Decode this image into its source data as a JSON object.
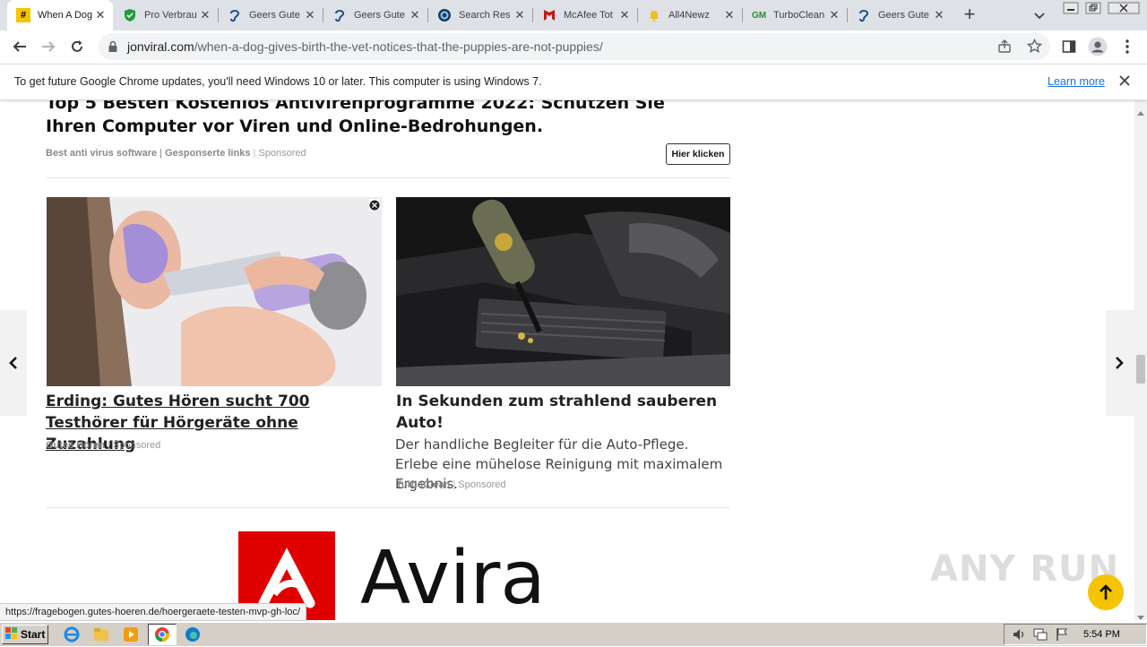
{
  "tabs": [
    {
      "title": "When A Dog",
      "icon": "hash-icon",
      "active": true
    },
    {
      "title": "Pro Verbrau",
      "icon": "shield-check-icon"
    },
    {
      "title": "Geers Gute",
      "icon": "ear-icon"
    },
    {
      "title": "Geers Gute",
      "icon": "ear-icon"
    },
    {
      "title": "Search Res",
      "icon": "search-engine-icon"
    },
    {
      "title": "McAfee Tot",
      "icon": "mcafee-icon"
    },
    {
      "title": "All4Newz",
      "icon": "bell-icon"
    },
    {
      "title": "TurboClean",
      "icon": "gm-icon"
    },
    {
      "title": "Geers Gute",
      "icon": "ear-icon"
    }
  ],
  "new_tab_label": "+",
  "address": {
    "domain": "jonviral.com",
    "path": "/when-a-dog-gives-birth-the-vet-notices-that-the-puppies-are-not-puppies/"
  },
  "infobar": {
    "message": "To get future Google Chrome updates, you'll need Windows 10 or later. This computer is using Windows 7.",
    "link": "Learn more"
  },
  "ad_top": {
    "title": "Top 5 Besten Kostenlos Antivirenprogramme 2022: Schützen Sie Ihren Computer vor Viren und Online-Bedrohungen.",
    "source1": "Best anti virus software",
    "source2": "Gesponserte links",
    "sponsored": "Sponsored",
    "cta": "Hier klicken"
  },
  "card1": {
    "title": "Erding: Gutes Hören sucht 700 Testhörer für Hörgeräte ohne Zuzahlung",
    "source": "Gutes Hören",
    "sponsored": "Sponsored"
  },
  "card2": {
    "title": "In Sekunden zum strahlend sauberen Auto!",
    "desc": "Der handliche Begleiter für die Auto-Pflege. Erlebe eine mühelose Reinigung mit maximalem Ergebnis.",
    "source": "TurboClean",
    "sponsored": "Sponsored"
  },
  "avira_logo_text": "Avira",
  "watermark": "ANY RUN",
  "status_url": "https://fragebogen.gutes-hoeren.de/hoergeraete-testen-mvp-gh-loc/",
  "taskbar": {
    "start": "Start",
    "clock": "5:54 PM"
  },
  "colors": {
    "accent_chrome": "#1a73e8",
    "avira_red": "#e00000",
    "scroll_top_button": "#f5c400"
  }
}
